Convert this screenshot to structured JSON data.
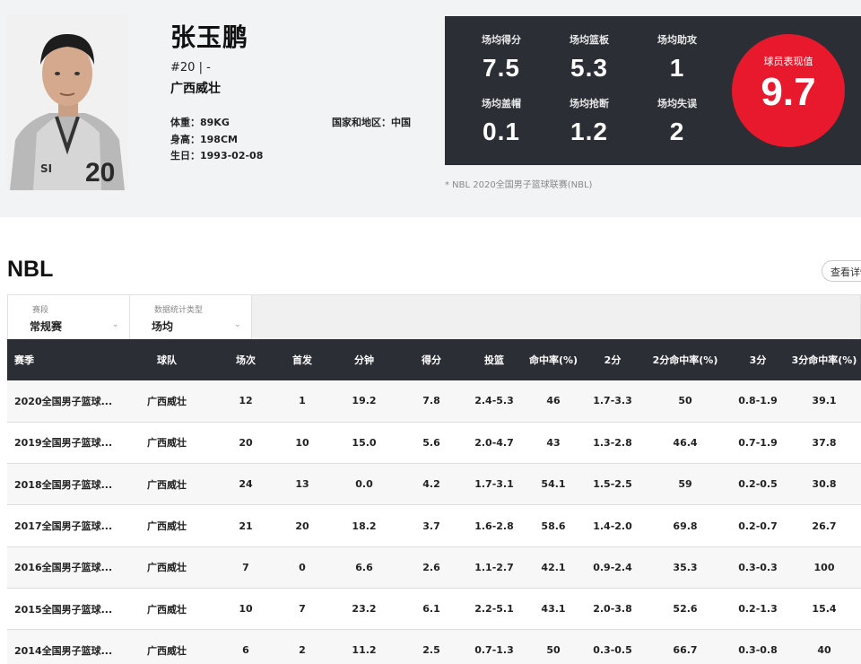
{
  "player": {
    "name": "张玉鹏",
    "number": "#20 | -",
    "team": "广西威壮",
    "weight": "体重：89KG",
    "height": "身高：198CM",
    "birthday": "生日：1993-02-08",
    "region": "国家和地区：中国",
    "jersey_text": "20",
    "jersey_logo": "SI"
  },
  "stats": [
    {
      "label": "场均得分",
      "value": "7.5"
    },
    {
      "label": "场均篮板",
      "value": "5.3"
    },
    {
      "label": "场均助攻",
      "value": "1"
    },
    {
      "label": "场均盖帽",
      "value": "0.1"
    },
    {
      "label": "场均抢断",
      "value": "1.2"
    },
    {
      "label": "场均失误",
      "value": "2"
    }
  ],
  "rating": {
    "label": "球员表现值",
    "value": "9.7"
  },
  "footnote": "* NBL 2020全国男子篮球联赛(NBL)",
  "section": {
    "title": "NBL",
    "detail_button": "查看详情"
  },
  "filters": [
    {
      "label": "赛段",
      "value": "常规赛"
    },
    {
      "label": "数据统计类型",
      "value": "场均"
    }
  ],
  "table": {
    "headers": [
      "赛季",
      "球队",
      "场次",
      "首发",
      "分钟",
      "得分",
      "投篮",
      "命中率(%)",
      "2分",
      "2分命中率(%)",
      "3分",
      "3分命中率(%)"
    ],
    "rows": [
      [
        "2020全国男子篮球...",
        "广西威壮",
        "12",
        "1",
        "19.2",
        "7.8",
        "2.4-5.3",
        "46",
        "1.7-3.3",
        "50",
        "0.8-1.9",
        "39.1"
      ],
      [
        "2019全国男子篮球...",
        "广西威壮",
        "20",
        "10",
        "15.0",
        "5.6",
        "2.0-4.7",
        "43",
        "1.3-2.8",
        "46.4",
        "0.7-1.9",
        "37.8"
      ],
      [
        "2018全国男子篮球...",
        "广西威壮",
        "24",
        "13",
        "0.0",
        "4.2",
        "1.7-3.1",
        "54.1",
        "1.5-2.5",
        "59",
        "0.2-0.5",
        "30.8"
      ],
      [
        "2017全国男子篮球...",
        "广西威壮",
        "21",
        "20",
        "18.2",
        "3.7",
        "1.6-2.8",
        "58.6",
        "1.4-2.0",
        "69.8",
        "0.2-0.7",
        "26.7"
      ],
      [
        "2016全国男子篮球...",
        "广西威壮",
        "7",
        "0",
        "6.6",
        "2.6",
        "1.1-2.7",
        "42.1",
        "0.9-2.4",
        "35.3",
        "0.3-0.3",
        "100"
      ],
      [
        "2015全国男子篮球...",
        "广西威壮",
        "10",
        "7",
        "23.2",
        "6.1",
        "2.2-5.1",
        "43.1",
        "2.0-3.8",
        "52.6",
        "0.2-1.3",
        "15.4"
      ],
      [
        "2014全国男子篮球...",
        "广西威壮",
        "6",
        "2",
        "11.2",
        "2.5",
        "0.7-1.3",
        "50",
        "0.3-0.5",
        "66.7",
        "0.3-0.8",
        "40"
      ]
    ]
  },
  "colors": {
    "dark_panel": "#2b2e34",
    "accent_red": "#e8192c",
    "profile_bg": "#f2f3f5"
  }
}
